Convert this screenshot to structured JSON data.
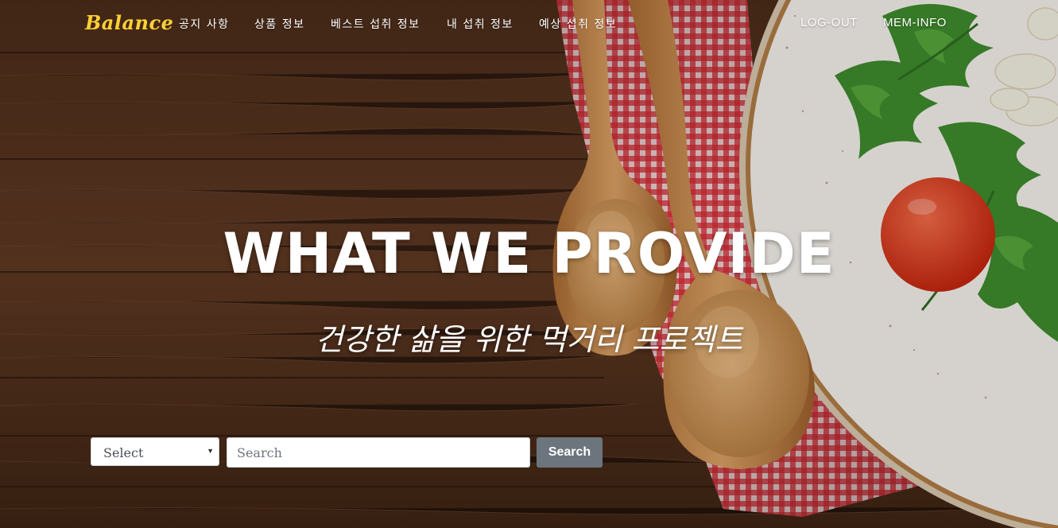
{
  "brand": {
    "name": "Balance",
    "color": "#fed136"
  },
  "nav": {
    "items": [
      {
        "label": "공지 사항"
      },
      {
        "label": "상품 정보"
      },
      {
        "label": "베스트 섭취 정보"
      },
      {
        "label": "내 섭취 정보"
      },
      {
        "label": "예상 섭취 정보"
      }
    ],
    "right": [
      {
        "label": "LOG-OUT"
      },
      {
        "label": "MEM-INFO"
      }
    ]
  },
  "hero": {
    "title": "WHAT WE PROVIDE",
    "subtitle": "건강한 삶을 위한 먹거리 프로젝트"
  },
  "search": {
    "select_value": "Select",
    "placeholder": "Search",
    "button_label": "Search"
  },
  "colors": {
    "wood": "#5a3520",
    "checkered": "#d92b34",
    "spoon": "#c98a4b",
    "plate": "#f3f0ea",
    "tomato": "#e23c22",
    "arugula": "#3e8a2d",
    "button": "#6c757d"
  }
}
